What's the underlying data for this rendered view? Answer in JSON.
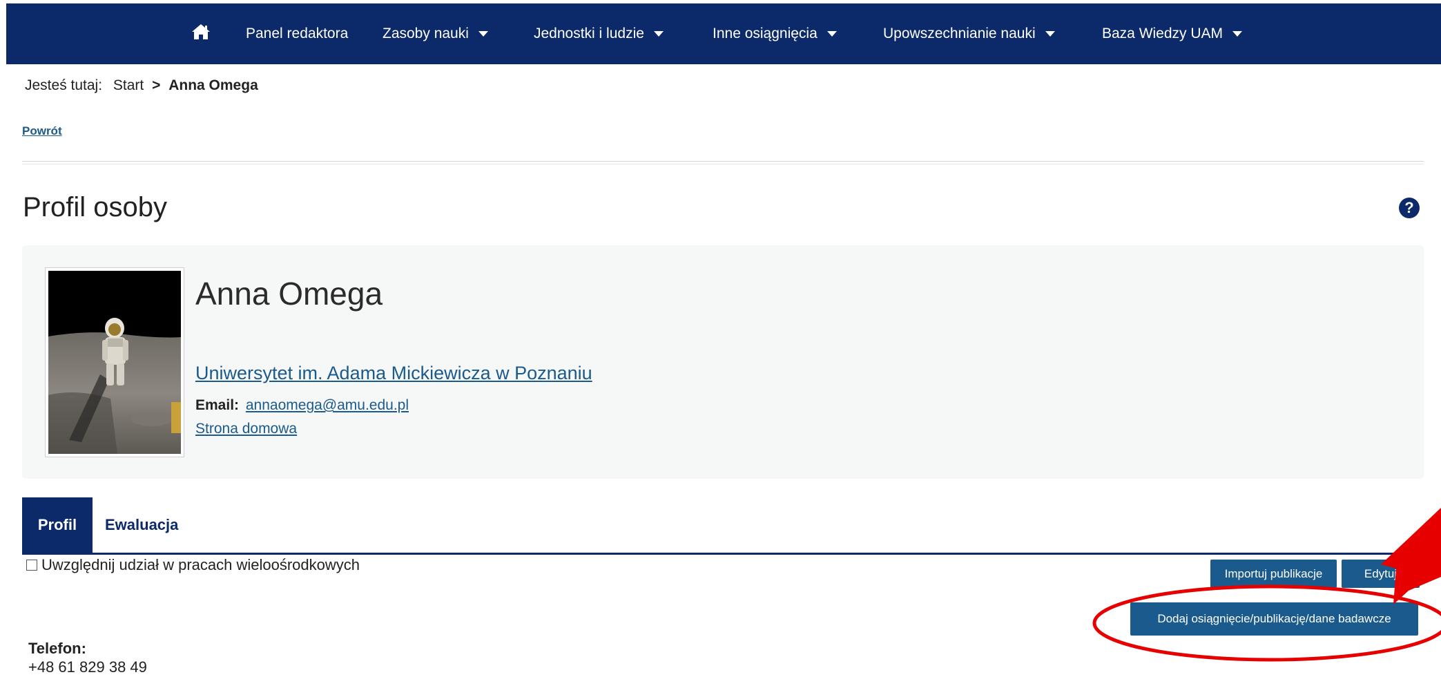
{
  "nav": {
    "home_icon": "home-icon",
    "items": [
      {
        "label": "Panel redaktora",
        "dropdown": false
      },
      {
        "label": "Zasoby nauki",
        "dropdown": true
      },
      {
        "label": "Jednostki i ludzie",
        "dropdown": true
      },
      {
        "label": "Inne osiągnięcia",
        "dropdown": true
      },
      {
        "label": "Upowszechnianie nauki",
        "dropdown": true
      },
      {
        "label": "Baza Wiedzy UAM",
        "dropdown": true
      }
    ]
  },
  "breadcrumb": {
    "prefix": "Jesteś tutaj:",
    "start": "Start",
    "separator": ">",
    "current": "Anna Omega"
  },
  "back_link": "Powrót",
  "page_title": "Profil osoby",
  "help_icon": "question-circle-icon",
  "profile": {
    "name": "Anna Omega",
    "affiliation": "Uniwersytet im. Adama Mickiewicza w Poznaniu",
    "email_label": "Email:",
    "email": "annaomega@amu.edu.pl",
    "homepage_label": "Strona domowa"
  },
  "tabs": [
    {
      "label": "Profil",
      "active": true
    },
    {
      "label": "Ewaluacja",
      "active": false
    }
  ],
  "multicenter_checkbox": {
    "label": "Uwzględnij udział w pracach wieloośrodkowych",
    "checked": false
  },
  "buttons": {
    "import": "Importuj publikacje",
    "edit": "Edytuj",
    "add": "Dodaj osiągnięcie/publikację/dane badawcze"
  },
  "contact": {
    "phone_label": "Telefon:",
    "phone": "+48 61 829 38 49"
  },
  "colors": {
    "nav_bg": "#0c2a6a",
    "button_bg": "#1a5a8c",
    "annotation": "#e60000"
  }
}
